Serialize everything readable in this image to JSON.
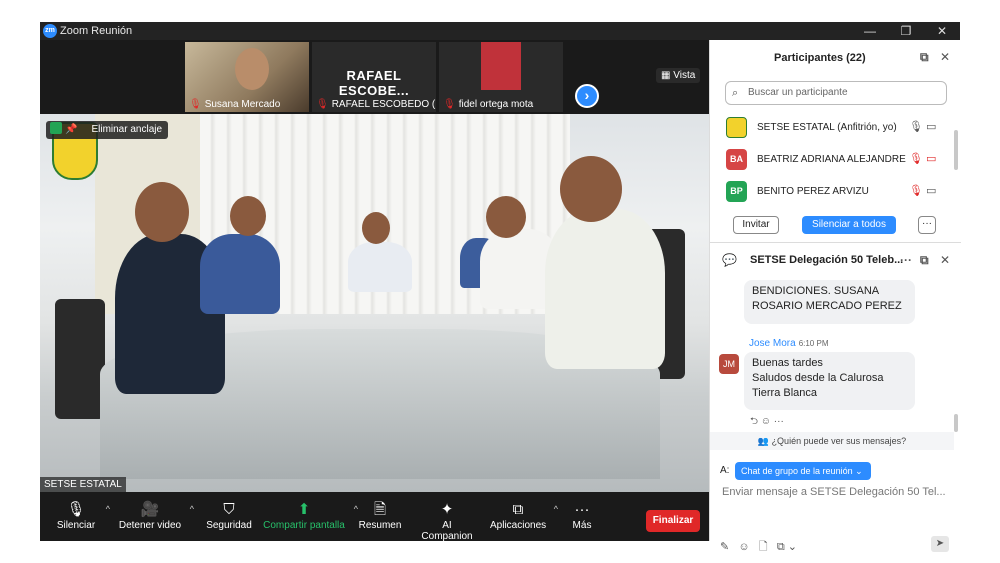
{
  "window": {
    "title": "Zoom Reunión",
    "logo": "zm"
  },
  "gallery": {
    "thumbs": [
      {
        "name": "Susana Mercado"
      },
      {
        "name": "RAFAEL ESCOBEDO (P...",
        "display": "RAFAEL  ESCOBE..."
      },
      {
        "name": "fidel ortega mota"
      }
    ],
    "view_label": "Vista"
  },
  "main_video": {
    "name_tag": "SETSE ESTATAL",
    "pin_label": "Eliminar anclaje"
  },
  "toolbar": {
    "items": [
      {
        "label": "Silenciar",
        "icon": "microphone-icon"
      },
      {
        "label": "Detener video",
        "icon": "video-camera-icon"
      },
      {
        "label": "Seguridad",
        "icon": "shield-icon"
      },
      {
        "label": "Compartir pantalla",
        "icon": "share-screen-icon"
      },
      {
        "label": "Resumen",
        "icon": "summary-icon"
      },
      {
        "label": "AI Companion",
        "icon": "sparkle-icon"
      },
      {
        "label": "Aplicaciones",
        "icon": "apps-icon"
      },
      {
        "label": "Más",
        "icon": "more-icon"
      }
    ],
    "end_label": "Finalizar",
    "share_color": "#27c06a",
    "end_color": "#e02828"
  },
  "participants": {
    "title": "Participantes (22)",
    "search_placeholder": "Buscar un participante",
    "list": [
      {
        "initials": "",
        "name": "SETSE ESTATAL (Anfitrión, yo)",
        "color": "#f2d22c",
        "muted": false
      },
      {
        "initials": "BA",
        "name": "BEATRIZ ADRIANA ALEJANDRE",
        "color": "#d64545",
        "muted": true
      },
      {
        "initials": "BP",
        "name": "BENITO PEREZ ARVIZU",
        "color": "#23a455",
        "muted": true
      }
    ],
    "invite_label": "Invitar",
    "mute_all_label": "Silenciar a todos",
    "more_label": "···"
  },
  "chat": {
    "title": "SETSE Delegación 50 Teleb...",
    "prev_message_tail": "BENDICIONES. SUSANA\nROSARIO MERCADO PEREZ",
    "sender": "Jose Mora",
    "sender_initials": "JM",
    "time": "6:10 PM",
    "message_lines": [
      "Buenas tardes",
      "Saludos desde la Calurosa",
      "Tierra Blanca"
    ],
    "who_sees": "¿Quién puede ver sus mensajes?",
    "to_label": "A:",
    "to_value": "Chat de grupo de la reunión",
    "compose_placeholder": "Enviar mensaje a SETSE Delegación 50 Tel..."
  },
  "colors": {
    "accent": "#2d8cff",
    "bg_dark": "#1a1a1a"
  }
}
